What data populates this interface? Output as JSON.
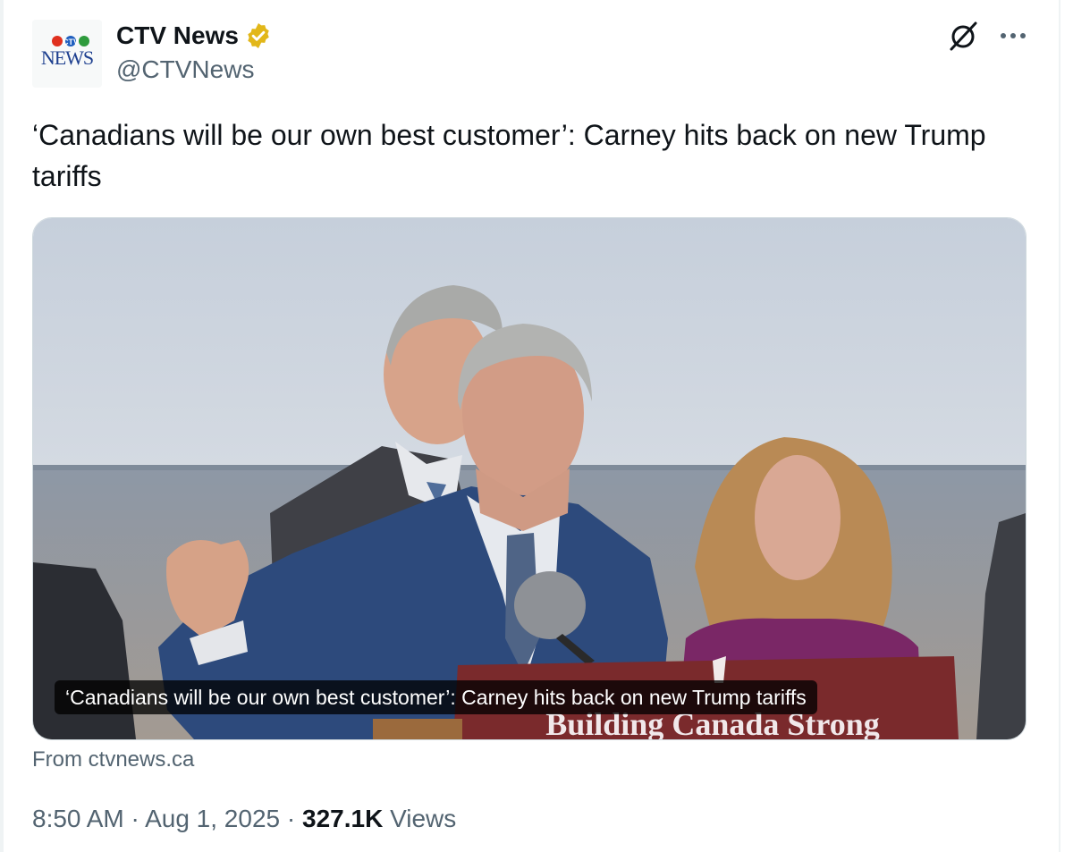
{
  "account": {
    "display_name": "CTV News",
    "handle": "@CTVNews",
    "logo_text_top": "CTV",
    "logo_text_bottom": "NEWS"
  },
  "icons": {
    "verified": "verified-badge-gold",
    "grok": "grok-slash-circle-icon",
    "more": "more-horizontal-icon"
  },
  "tweet": {
    "text": "‘Canadians will be our own best customer’: Carney hits back on new Trump tariffs"
  },
  "card": {
    "title": "‘Canadians will be our own best customer’: Carney hits back on new Trump tariffs",
    "podium_text": "Building Canada Strong",
    "source": "From ctvnews.ca"
  },
  "meta": {
    "time": "8:50 AM",
    "separator": " · ",
    "date": "Aug 1, 2025",
    "views_count": "327.1K",
    "views_label": " Views"
  },
  "colors": {
    "text_primary": "#0f1419",
    "text_secondary": "#536471",
    "verified_gold": "#e2b719",
    "border": "#cfd9de"
  }
}
